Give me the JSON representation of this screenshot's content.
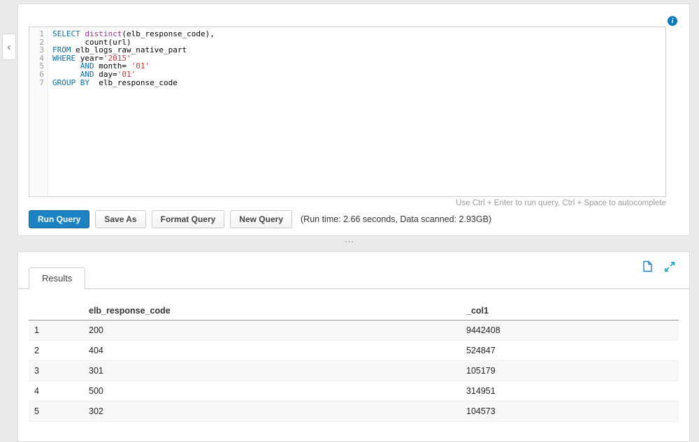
{
  "collapse_glyph": "‹",
  "info_glyph": "i",
  "editor": {
    "lines": [
      [
        {
          "t": "SELECT",
          "c": "kw"
        },
        {
          "t": " ",
          "c": "pl"
        },
        {
          "t": "distinct",
          "c": "fn"
        },
        {
          "t": "(elb_response_code),",
          "c": "pl"
        }
      ],
      [
        {
          "t": "       count(url)",
          "c": "pl"
        }
      ],
      [
        {
          "t": "FROM",
          "c": "kw"
        },
        {
          "t": " elb_logs_raw_native_part",
          "c": "pl"
        }
      ],
      [
        {
          "t": "WHERE",
          "c": "kw"
        },
        {
          "t": " year=",
          "c": "pl"
        },
        {
          "t": "'2015'",
          "c": "str"
        }
      ],
      [
        {
          "t": "      ",
          "c": "pl"
        },
        {
          "t": "AND",
          "c": "kw"
        },
        {
          "t": " month= ",
          "c": "pl"
        },
        {
          "t": "'01'",
          "c": "str"
        }
      ],
      [
        {
          "t": "      ",
          "c": "pl"
        },
        {
          "t": "AND",
          "c": "kw"
        },
        {
          "t": " day=",
          "c": "pl"
        },
        {
          "t": "'01'",
          "c": "str"
        }
      ],
      [
        {
          "t": "GROUP BY",
          "c": "kw"
        },
        {
          "t": "  elb_response_code",
          "c": "pl"
        }
      ]
    ],
    "hint": "Use Ctrl + Enter to run query, Ctrl + Space to autocomplete"
  },
  "toolbar": {
    "run_label": "Run Query",
    "save_as_label": "Save As",
    "format_label": "Format Query",
    "new_label": "New Query",
    "stats": "(Run time: 2.66 seconds, Data scanned: 2.93GB)"
  },
  "splitter_glyph": "...",
  "results": {
    "tab_label": "Results",
    "columns": [
      "elb_response_code",
      "_col1"
    ],
    "rows": [
      [
        "1",
        "200",
        "9442408"
      ],
      [
        "2",
        "404",
        "524847"
      ],
      [
        "3",
        "301",
        "105179"
      ],
      [
        "4",
        "500",
        "314951"
      ],
      [
        "5",
        "302",
        "104573"
      ]
    ]
  },
  "colors": {
    "primary_button": "#1d82c2",
    "info_icon": "#0c7bbb",
    "export_icon": "#1f7ec1",
    "expand_icon": "#1aa7c9",
    "keyword": "#0c6ca6",
    "function": "#9b2d9b",
    "string": "#cb3737"
  }
}
